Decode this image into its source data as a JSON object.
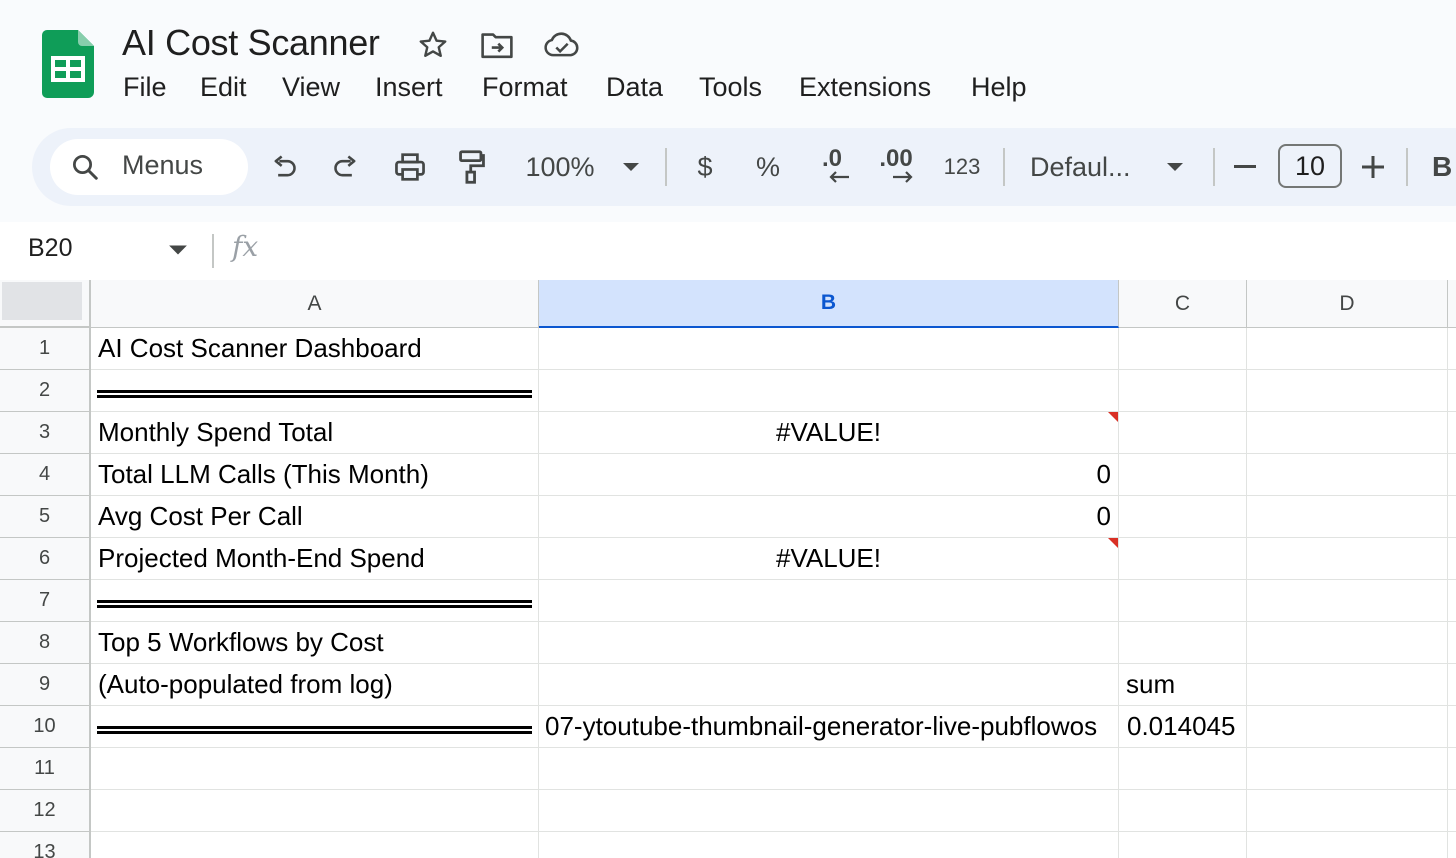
{
  "app": {
    "title": "AI Cost Scanner",
    "menu": [
      "File",
      "Edit",
      "View",
      "Insert",
      "Format",
      "Data",
      "Tools",
      "Extensions",
      "Help"
    ]
  },
  "toolbar": {
    "search_label": "Menus",
    "zoom": "100%",
    "currency": "$",
    "percent": "%",
    "decrease_decimal": ".0",
    "increase_decimal": ".00",
    "number_format": "123",
    "font": "Defaul...",
    "font_size": "10",
    "bold": "B"
  },
  "formula_bar": {
    "cell_ref": "B20",
    "fx": "fx",
    "formula": ""
  },
  "sheet": {
    "columns": [
      "A",
      "B",
      "C",
      "D"
    ],
    "selected_column": "B",
    "rows": [
      {
        "num": "1",
        "A": "AI Cost Scanner Dashboard",
        "B": "",
        "C": ""
      },
      {
        "num": "2",
        "A": "════",
        "B": "",
        "C": ""
      },
      {
        "num": "3",
        "A": "Monthly Spend Total",
        "B": "#VALUE!",
        "C": ""
      },
      {
        "num": "4",
        "A": "Total LLM Calls (This Month)",
        "B": "0",
        "C": ""
      },
      {
        "num": "5",
        "A": "Avg Cost Per Call",
        "B": "0",
        "C": ""
      },
      {
        "num": "6",
        "A": "Projected Month-End Spend",
        "B": "#VALUE!",
        "C": ""
      },
      {
        "num": "7",
        "A": "════",
        "B": "",
        "C": ""
      },
      {
        "num": "8",
        "A": "Top 5 Workflows by Cost",
        "B": "",
        "C": ""
      },
      {
        "num": "9",
        "A": "(Auto-populated from log)",
        "B": "",
        "C": "sum"
      },
      {
        "num": "10",
        "A": "════",
        "B": "07-ytoutube-thumbnail-generator-live-pubflowos",
        "C": "0.014045"
      },
      {
        "num": "11",
        "A": "",
        "B": "",
        "C": ""
      },
      {
        "num": "12",
        "A": "",
        "B": "",
        "C": ""
      },
      {
        "num": "13",
        "A": "",
        "B": "",
        "C": ""
      }
    ]
  },
  "colors": {
    "accent": "#0b57d0",
    "selected_header": "#d3e3fd",
    "error_marker": "#d93025",
    "logo_green": "#0f9d58"
  },
  "icons": [
    "sheets-logo",
    "star-icon",
    "move-to-folder-icon",
    "cloud-saved-icon",
    "search-icon",
    "undo-icon",
    "redo-icon",
    "print-icon",
    "paint-format-icon",
    "dropdown-arrow-icon",
    "minus-icon",
    "plus-icon"
  ]
}
